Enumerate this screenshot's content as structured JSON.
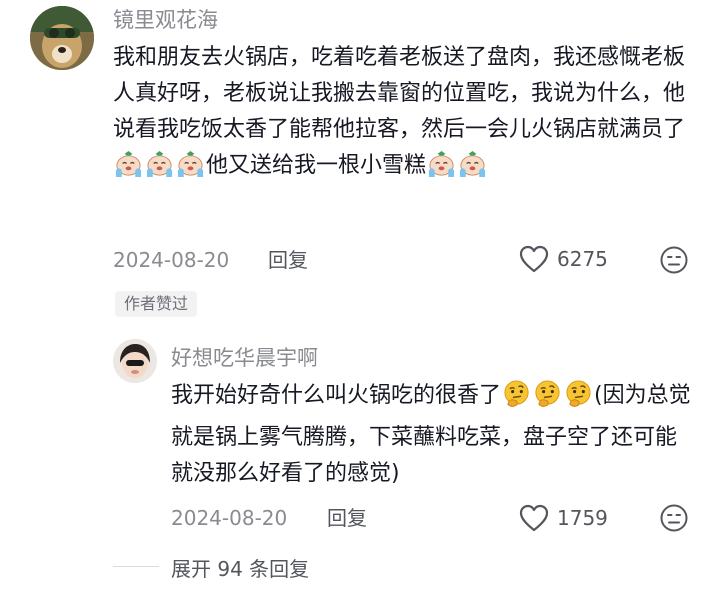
{
  "comment": {
    "username": "镜里观花海",
    "text_a": "我和朋友去火锅店，吃着吃着老板送了盘肉，我还感慨老板人真好呀，老板说让我搬去靠窗的位置吃，我说为什么，他说看我吃饭太香了能帮他拉客，然后一会儿火锅店就满员了",
    "emoji_a": [
      "cry-emoji",
      "cry-emoji",
      "cry-emoji"
    ],
    "text_b": "他又送给我一根小雪糕",
    "emoji_b": [
      "cry-emoji",
      "cry-emoji"
    ],
    "date": "2024-08-20",
    "reply_label": "回复",
    "like_count": "6275",
    "author_badge": "作者赞过"
  },
  "reply": {
    "username": "好想吃华晨宇啊",
    "text_a": "我开始好奇什么叫火锅吃的很香了",
    "emoji_a": [
      "thinking-emoji",
      "thinking-emoji",
      "thinking-emoji"
    ],
    "text_b": "(因为总觉就是锅上雾气腾腾，下菜蘸料吃菜，盘子空了还可能就没那么好看了的感觉)",
    "date": "2024-08-20",
    "reply_label": "回复",
    "like_count": "1759"
  },
  "expand": {
    "label": "展开 94 条回复"
  },
  "colors": {
    "text_primary": "#161823",
    "text_secondary": "#8a8b91",
    "badge_bg": "#f2f2f3"
  }
}
